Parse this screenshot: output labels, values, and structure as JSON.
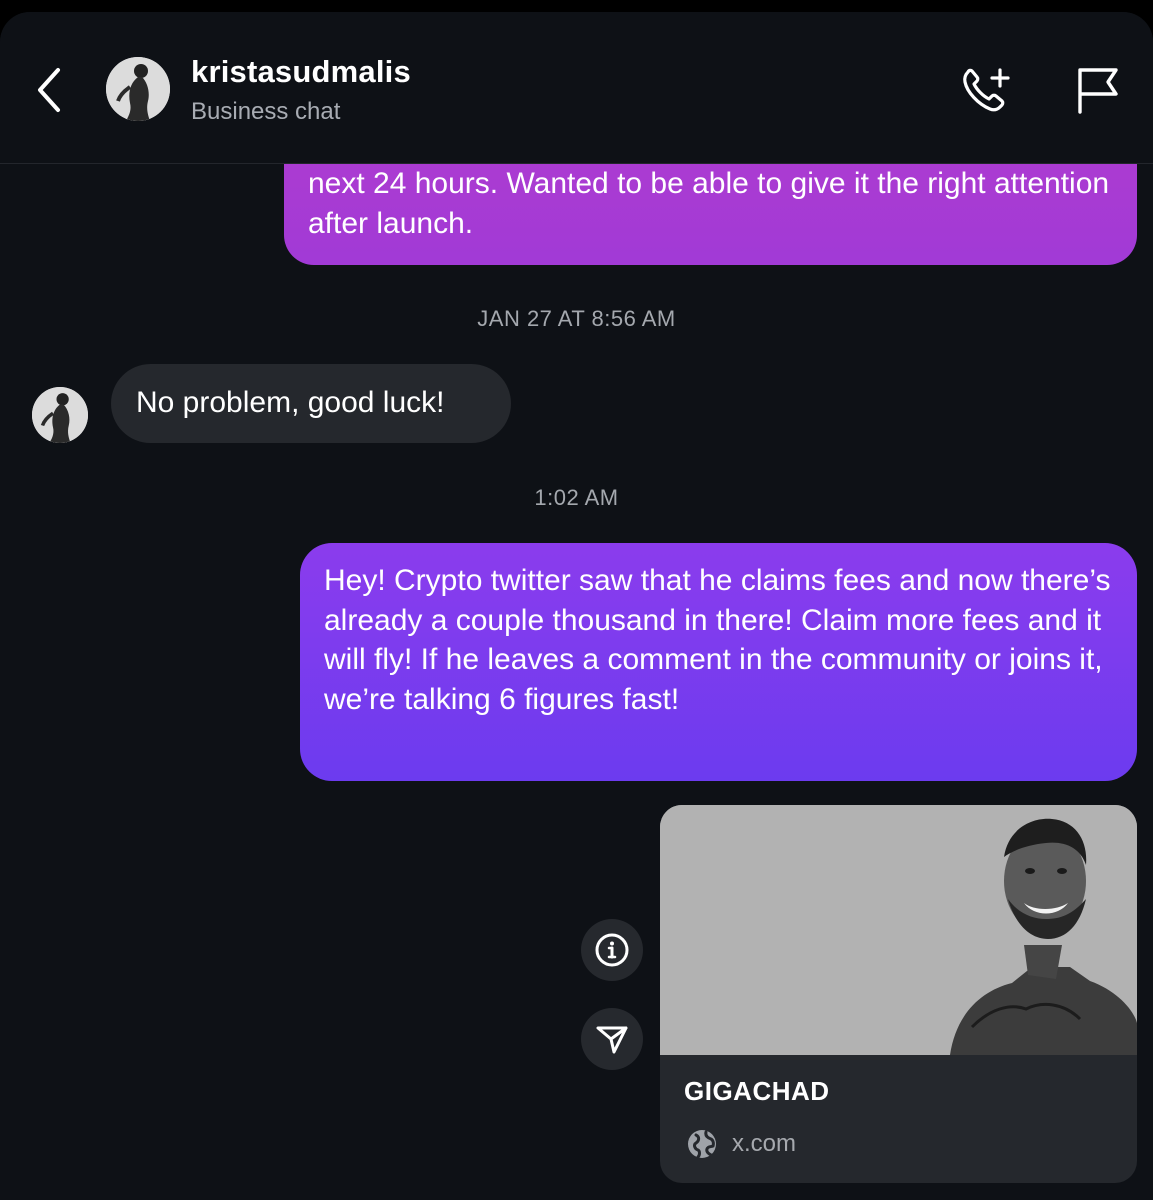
{
  "header": {
    "back_icon": "chevron-left-icon",
    "name": "kristasudmalis",
    "subtitle": "Business chat",
    "call_icon": "phone-add-icon",
    "flag_icon": "flag-icon"
  },
  "messages": {
    "outgoing_top_partial": "next 24 hours. Wanted to be able to give it the right attention after launch.",
    "timestamp_1": "JAN 27 AT 8:56 AM",
    "incoming_1": "No problem, good luck!",
    "timestamp_2": "1:02 AM",
    "outgoing_2": "Hey! Crypto twitter saw that he claims fees and now there’s already a couple thousand in there! Claim more fees and it will fly! If he leaves a comment in the community or joins it, we’re talking 6 figures fast!"
  },
  "link_card": {
    "title": "GIGACHAD",
    "domain": "x.com",
    "domain_icon": "globe-icon"
  },
  "actions": {
    "info_icon": "info-icon",
    "share_icon": "send-icon"
  },
  "colors": {
    "background": "#0e1116",
    "outgoing_gradient_top": "#b03ccf",
    "outgoing_gradient_purple": "#6c3bef",
    "incoming_bubble": "#25282d"
  }
}
